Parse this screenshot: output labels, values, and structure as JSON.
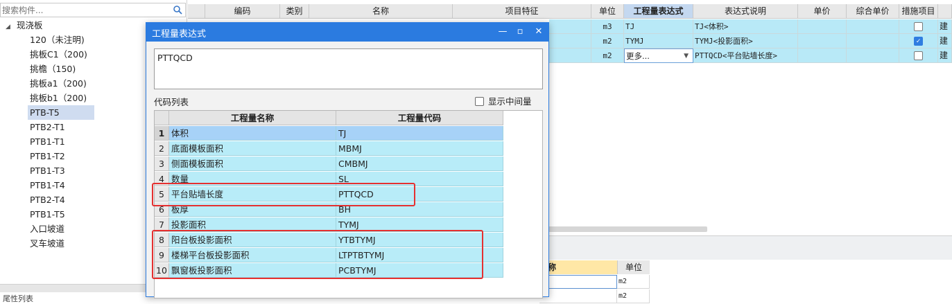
{
  "left_panel": {
    "search_placeholder": "搜索构件...",
    "root": "现浇板",
    "items": [
      {
        "label": "120（未注明)"
      },
      {
        "label": "挑板C1（200)"
      },
      {
        "label": "挑檐（150)"
      },
      {
        "label": "挑板a1（200)"
      },
      {
        "label": "挑板b1（200)"
      },
      {
        "label": "PTB-T5"
      },
      {
        "label": "PTB2-T1"
      },
      {
        "label": "PTB1-T1"
      },
      {
        "label": "PTB1-T2"
      },
      {
        "label": "PTB1-T3"
      },
      {
        "label": "PTB1-T4"
      },
      {
        "label": "PTB2-T4"
      },
      {
        "label": "PTB1-T5"
      },
      {
        "label": "入口坡道"
      },
      {
        "label": "叉车坡道"
      }
    ],
    "selected_index": 5,
    "bottom_label": "尾性列表"
  },
  "main_table": {
    "headers": {
      "code": "编码",
      "category": "类别",
      "name": "名称",
      "feature": "项目特征",
      "unit": "单位",
      "expr": "工程量表达式",
      "expr_desc": "表达式说明",
      "price": "单价",
      "total_price": "综合单价",
      "measure": "措施项目"
    },
    "rows": [
      {
        "unit": "m3",
        "expr": "TJ",
        "desc": "TJ<体积>",
        "checked": false,
        "last": "建"
      },
      {
        "unit": "m2",
        "expr": "TYMJ",
        "desc": "TYMJ<投影面积>",
        "checked": true,
        "last": "建"
      },
      {
        "unit": "m2",
        "expr": "更多...",
        "desc": "PTTQCD<平台贴墙长度>",
        "checked": false,
        "last": "建"
      }
    ]
  },
  "bottom_table": {
    "header_name_partial": "称",
    "header_unit": "单位",
    "rows": [
      {
        "unit": "m2"
      },
      {
        "unit": "m2"
      }
    ]
  },
  "dialog": {
    "title": "工程量表达式",
    "expression": "PTTQCD",
    "code_list_label": "代码列表",
    "show_intermediate_label": "显示中间量",
    "col_name": "工程量名称",
    "col_code": "工程量代码",
    "rows": [
      {
        "no": "1",
        "name": "体积",
        "code": "TJ"
      },
      {
        "no": "2",
        "name": "底面模板面积",
        "code": "MBMJ"
      },
      {
        "no": "3",
        "name": "侧面模板面积",
        "code": "CMBMJ"
      },
      {
        "no": "4",
        "name": "数量",
        "code": "SL"
      },
      {
        "no": "5",
        "name": "平台贴墙长度",
        "code": "PTTQCD"
      },
      {
        "no": "6",
        "name": "板厚",
        "code": "BH"
      },
      {
        "no": "7",
        "name": "投影面积",
        "code": "TYMJ"
      },
      {
        "no": "8",
        "name": "阳台板投影面积",
        "code": "YTBTYMJ"
      },
      {
        "no": "9",
        "name": "楼梯平台板投影面积",
        "code": "LTPTBTYMJ"
      },
      {
        "no": "10",
        "name": "飘窗板投影面积",
        "code": "PCBTYMJ"
      }
    ],
    "selected_row": 1,
    "highlight_color": "#e53030",
    "title_bar_color": "#2b7be0"
  }
}
